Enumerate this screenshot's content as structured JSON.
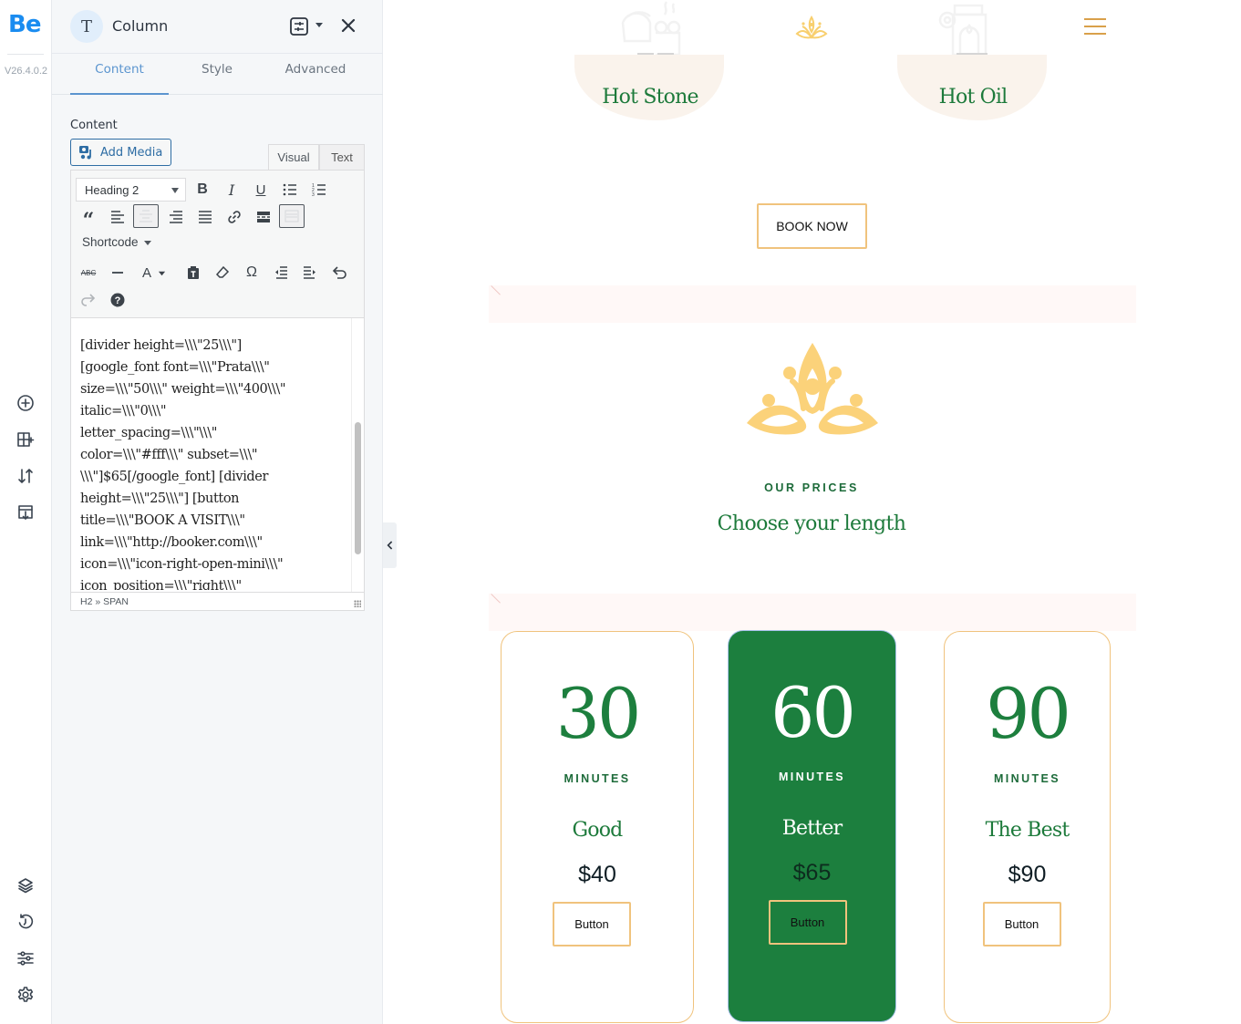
{
  "rail": {
    "logo": "Be",
    "version": "V26.4.0.2",
    "top_icons": [
      "add-element-icon",
      "add-section-icon",
      "sort-icon",
      "import-template-icon"
    ],
    "bottom_icons": [
      "layers-icon",
      "history-icon",
      "options-icon",
      "settings-icon"
    ]
  },
  "panel": {
    "avatar_letter": "T",
    "title": "Column",
    "tabs": [
      {
        "label": "Content",
        "active": true
      },
      {
        "label": "Style",
        "active": false
      },
      {
        "label": "Advanced",
        "active": false
      }
    ],
    "field_label": "Content",
    "add_media_label": "Add Media",
    "editor_tabs": [
      {
        "label": "Visual",
        "active": true
      },
      {
        "label": "Text",
        "active": false
      }
    ],
    "format_select": "Heading 2",
    "shortcode_label": "Shortcode",
    "status_path": "H2 » SPAN",
    "content_lines": [
      "[divider height=\\\\\\\"25\\\\\\\"]",
      "[google_font font=\\\\\\\"Prata\\\\\\\"",
      "size=\\\\\\\"50\\\\\\\" weight=\\\\\\\"400\\\\\\\"",
      "italic=\\\\\\\"0\\\\\\\"",
      "letter_spacing=\\\\\\\"\\\\\\\"",
      "color=\\\\\\\"#fff\\\\\\\" subset=\\\\\\\"",
      "\\\\\\\"]$65[/google_font] [divider",
      "height=\\\\\\\"25\\\\\\\"] [button",
      "title=\\\\\\\"BOOK A VISIT\\\\\\\"",
      "link=\\\\\\\"http://booker.com\\\\\\\"",
      "icon=\\\\\\\"icon-right-open-mini\\\\\\\"",
      "icon_position=\\\\\\\"right\\\\\\\""
    ]
  },
  "site": {
    "services": [
      {
        "title": "Hot Stone",
        "icon": "hot-stone-massage-icon"
      },
      {
        "title": "Hot Oil",
        "icon": "oil-burner-icon"
      }
    ],
    "book_now_label": "BOOK NOW",
    "eyebrow": "OUR PRICES",
    "headline": "Choose your length",
    "plans": [
      {
        "minutes": "30",
        "unit": "MINUTES",
        "tier": "Good",
        "price": "$40",
        "button": "Button",
        "featured": false
      },
      {
        "minutes": "60",
        "unit": "MINUTES",
        "tier": "Better",
        "price": "$65",
        "button": "Button",
        "featured": true
      },
      {
        "minutes": "90",
        "unit": "MINUTES",
        "tier": "The Best",
        "price": "$90",
        "button": "Button",
        "featured": false
      }
    ]
  },
  "colors": {
    "brand_green": "#1c7f3e",
    "accent_gold": "#f0c37d",
    "builder_blue": "#5b95cf"
  }
}
